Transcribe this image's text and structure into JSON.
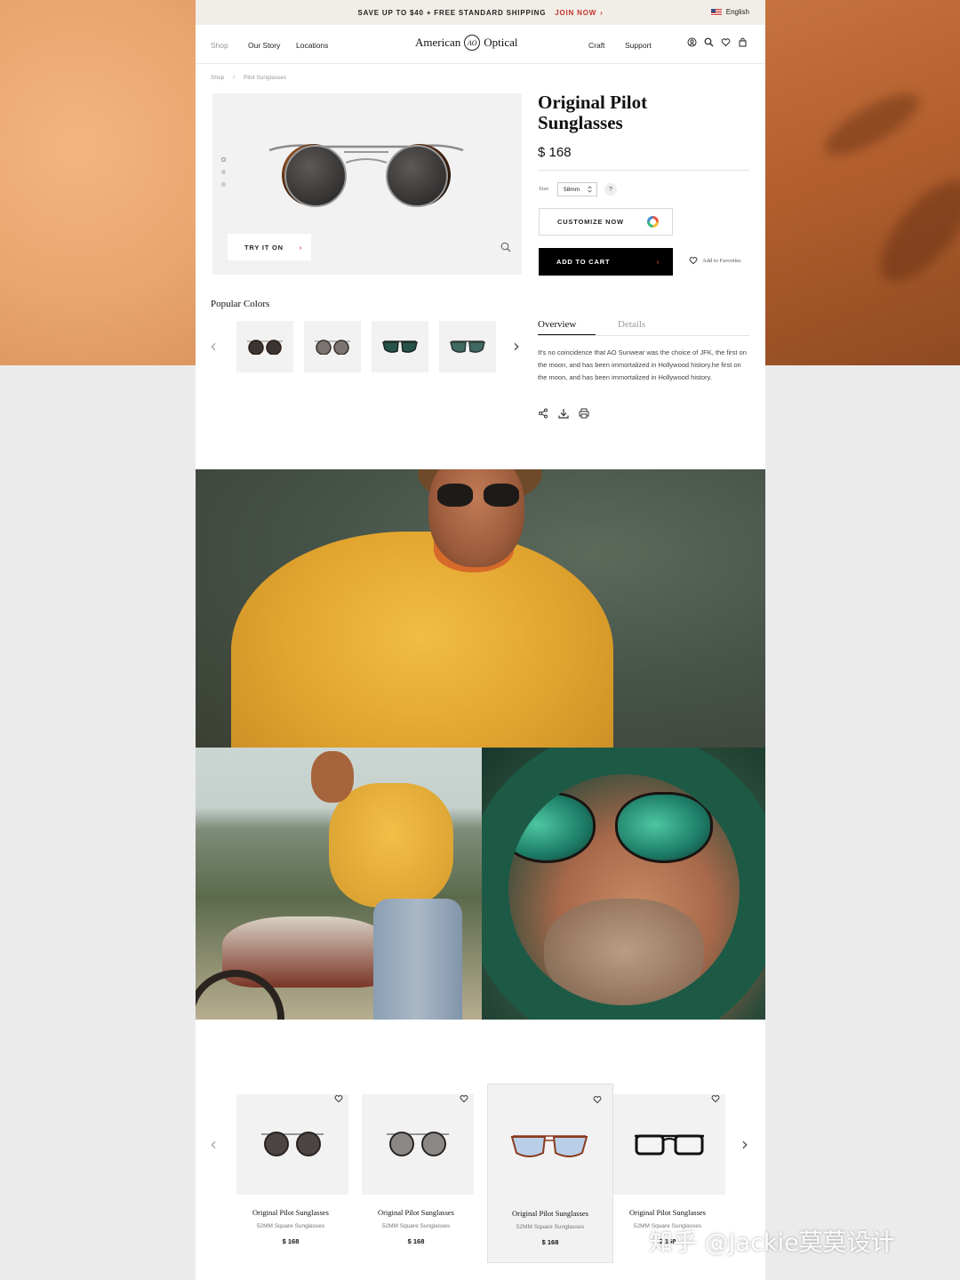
{
  "promo": {
    "text": "SAVE UP TO $40 + FREE STANDARD SHIPPING",
    "link": "JOIN NOW",
    "language": "English"
  },
  "nav": {
    "left": [
      "Shop",
      "Our Story",
      "Locations"
    ],
    "right": [
      "Craft",
      "Support"
    ],
    "logo_left": "American",
    "logo_mark": "AO",
    "logo_right": "Optical",
    "icons": [
      "account-icon",
      "search-icon",
      "heart-icon",
      "bag-icon"
    ]
  },
  "breadcrumb": [
    "Shop",
    "/",
    "Pilot Sunglasses"
  ],
  "product": {
    "title": "Original Pilot Sunglasses",
    "price": "$ 168",
    "size_label": "Size",
    "size_value": "58mm",
    "size_help": "?",
    "customize_label": "CUSTOMIZE NOW",
    "add_to_cart_label": "ADD TO CART",
    "favorites_label": "Add to Favorites",
    "try_it_on_label": "TRY IT ON"
  },
  "popular_colors": {
    "title": "Popular Colors",
    "swatches": [
      {
        "lens": "#3a3432",
        "frame": "#2b1c14"
      },
      {
        "lens": "#7a7472",
        "frame": "#3a2e2a"
      },
      {
        "lens": "#27544a",
        "frame": "#1c2622"
      },
      {
        "lens": "#3e6a62",
        "frame": "#2b3a36"
      }
    ]
  },
  "tabs": {
    "overview": "Overview",
    "details": "Details"
  },
  "overview_text": "It's no coincidence that AO Sunwear was the choice of JFK, the first on the moon, and has been immortalized in Hollywood history.he first on the moon, and has been immortalized in Hollywood history.",
  "share_icons": [
    "share-icon",
    "download-icon",
    "print-icon"
  ],
  "related": [
    {
      "name": "Original Pilot Sunglasses",
      "subtitle": "52MM Square Sunglasses",
      "price": "$ 168",
      "style": "round-dark",
      "lens": "#4a4543",
      "frame": "#2a2220"
    },
    {
      "name": "Original Pilot Sunglasses",
      "subtitle": "52MM Square Sunglasses",
      "price": "$ 168",
      "style": "round-gray",
      "lens": "#8c8886",
      "frame": "#2a2624"
    },
    {
      "name": "Original Pilot Sunglasses",
      "subtitle": "52MM Square Sunglasses",
      "price": "$ 168",
      "style": "aviator-blue",
      "lens": "#b9cfe8",
      "frame": "#8a3a1e"
    },
    {
      "name": "Original Pilot Sunglasses",
      "subtitle": "52MM Square Sunglasses",
      "price": "$ 168",
      "style": "square-black",
      "lens": "#f4f4f4",
      "frame": "#111111"
    }
  ],
  "watermark": "知乎 @Jackie莫莫设计",
  "colors": {
    "accent_red": "#c2342c",
    "promo_bg": "#f1eee7",
    "button_black": "#000000"
  }
}
